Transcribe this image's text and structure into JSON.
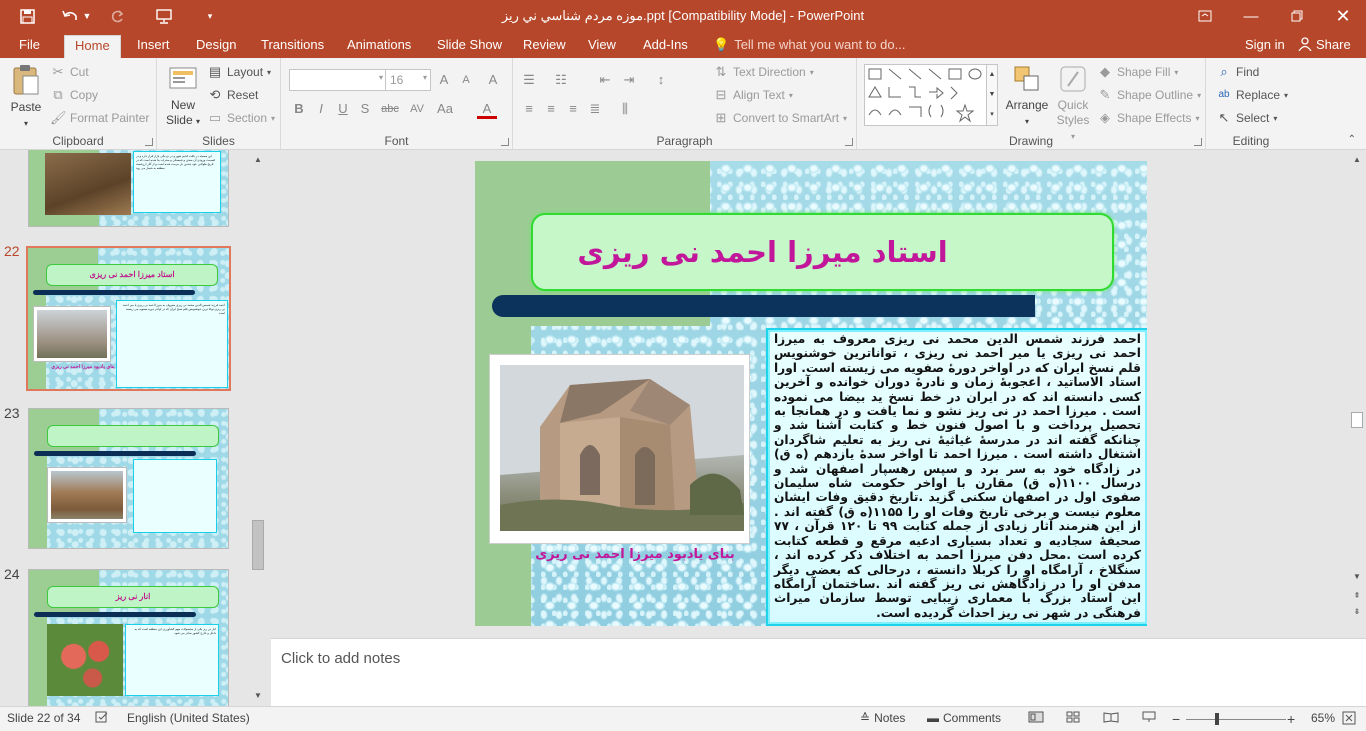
{
  "app": {
    "title": "موزه مردم شناسي ني ريز.ppt  [Compatibility Mode] - PowerPoint"
  },
  "qat": {
    "save_icon": "floppy-disk-icon",
    "undo_icon": "undo-arrow-icon",
    "redo_icon": "redo-arrow-icon",
    "present_icon": "presentation-icon",
    "customize_icon": "chevron-down-icon"
  },
  "tabs": [
    "File",
    "Home",
    "Insert",
    "Design",
    "Transitions",
    "Animations",
    "Slide Show",
    "Review",
    "View",
    "Add-Ins"
  ],
  "tell_me": "Tell me what you want to do...",
  "signin": "Sign in",
  "share": "Share",
  "ribbon": {
    "clipboard": {
      "paste": "Paste",
      "cut": "Cut",
      "copy": "Copy",
      "format_painter": "Format Painter",
      "label": "Clipboard"
    },
    "slides": {
      "new_slide_1": "New",
      "new_slide_2": "Slide",
      "layout": "Layout",
      "reset": "Reset",
      "section": "Section",
      "label": "Slides"
    },
    "font": {
      "font_name": "",
      "font_size": "16",
      "label": "Font",
      "bold": "B",
      "italic": "I",
      "underline": "U",
      "shadow": "S",
      "strike": "abc",
      "spacing": "AV",
      "case": "Aa",
      "color": "A",
      "grow": "A",
      "shrink": "A",
      "clear": "A"
    },
    "paragraph": {
      "text_direction": "Text Direction",
      "align_text": "Align Text",
      "smartart": "Convert to SmartArt",
      "label": "Paragraph"
    },
    "drawing": {
      "arrange": "Arrange",
      "quick_styles_1": "Quick",
      "quick_styles_2": "Styles",
      "shape_fill": "Shape Fill",
      "shape_outline": "Shape Outline",
      "shape_effects": "Shape Effects",
      "label": "Drawing"
    },
    "editing": {
      "find": "Find",
      "replace": "Replace",
      "select": "Select",
      "label": "Editing"
    }
  },
  "thumbnails": {
    "num22": "22",
    "num23": "23",
    "num24": "24",
    "t22_title": "استاد میرزا احمد نی ریزی",
    "t22_caption": "بنای یادبود میرزا احمد نی ریزی",
    "t24_title": "انار نی ریز",
    "t21_text": "این مسجد در بافت قديم شهر و در نزدیکی بازار قرار دارد و در قسمت ورودی آن صحن و شبستان و محراب بنا شده است که در تاریخ طولانی خود چندین بار مرمت شده است و از آثار ارزشمند منطقه به شمار می رود",
    "t22_text": "احمد فرزند شمس الدین محمد نی ریزی معروف به میرزا احمد نی ریزی یا میر احمد نی ریزی توانا ترین خوشنویس قلم نسخ ایران که در اواخر دوره صفویه می زیسته است",
    "t24_text": "انار نی ریز یکی از محصولات مهم کشاورزی این منطقه است که به داخل و خارج کشور صادر می شود"
  },
  "slide": {
    "title": "استاد میرزا احمد نی ریزی",
    "caption": "بنای یادبود میرزا احمد نی ریزی",
    "body": "احمد فرزند شمس الدین محمد نی ریزی معروف به میرزا احمد نی ریزی یا میر احمد نی ریزی ، تواناترین خوشنویس قلم نسخ ایران که در اواخر دورۀ صفویه می زیسته است. اورا استاد الاساتید ، اعجوبۀ زمان و نادرۀ دوران خوانده و آخرین کسی دانسته اند که در ایران در خط نسخ ید بیضا می نموده است . میرزا احمد در نی ریز نشو و نما یافت و در همانجا به تحصیل پرداخت و با اصول فنون خط و کتابت آشنا شد و چنانکه گفته اند در مدرسۀ غیاثیۀ نی ریز به تعلیم شاگردان اشتغال داشته است . میرزا احمد تا اواخر سدۀ یازدهم (ه ق) در زادگاه خود به سر برد و سپس رهسپار اصفهان شد و درسال ۱۱۰۰(ه ق) مقارن با اواخر حکومت شاه سلیمان صفوی اول در اصفهان سکنی گزید .تاریخ دقیق وفات ایشان معلوم نیست و برخی تاریخ وفات او را ۱۱۵۵(ه ق) گفته اند . از این هنرمند آثار زیادی از جمله کتابت ۹۹ تا ۱۲۰ قرآن ، ۷۷ صحیفۀ سجادیه و تعداد بسیاری ادعیه مرقع و قطعه کتابت کرده است .محل دفن میرزا احمد به اختلاف ذکر کرده اند ، سنگلاخ ، آرامگاه او را کربلا دانسته ، درحالی که بعضی دیگر مدفن او را در زادگاهش نی ریز گفته اند .ساختمان آرامگاه این استاد بزرگ با معماری زیبایی توسط سازمان میراث فرهنگی در شهر نی ریز احداث گردیده است."
  },
  "notes": {
    "placeholder": "Click to add notes"
  },
  "status": {
    "slide": "Slide 22 of 34",
    "language": "English (United States)",
    "notes": "Notes",
    "comments": "Comments",
    "zoom": "65%",
    "zoom_fraction": 0.65
  },
  "colors": {
    "accent": "#b7472a",
    "title_magenta": "#c2179a",
    "navy": "#0c335c",
    "green": "#9ccc94",
    "cyan": "#1fd3ea"
  }
}
